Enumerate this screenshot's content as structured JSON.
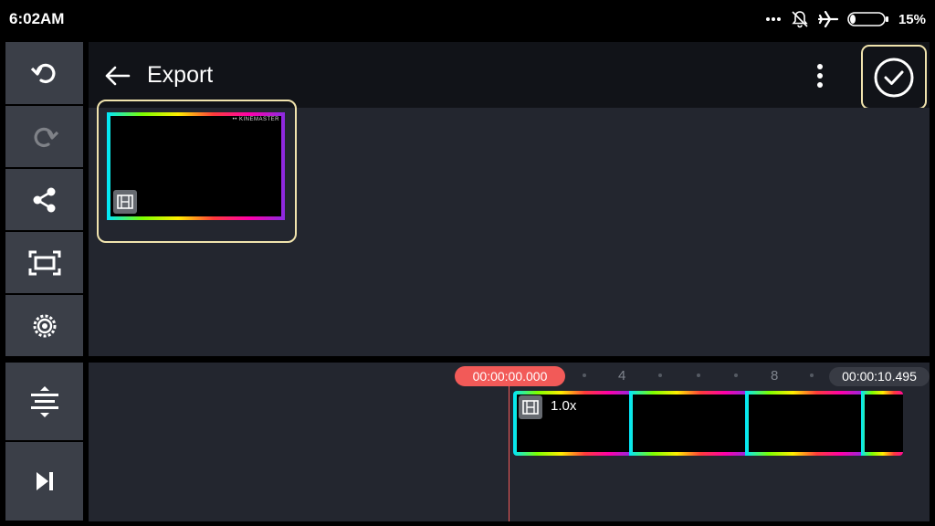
{
  "status_bar": {
    "time": "6:02AM",
    "battery": "15%",
    "icons": [
      "more-dots-icon",
      "bell-off-icon",
      "airplane-icon",
      "battery-icon"
    ]
  },
  "sidebar": {
    "buttons": [
      {
        "icon": "undo-icon",
        "enabled": true
      },
      {
        "icon": "redo-icon",
        "enabled": false
      },
      {
        "icon": "share-icon",
        "enabled": true
      },
      {
        "icon": "fit-screen-icon",
        "enabled": true
      },
      {
        "icon": "settings-icon",
        "enabled": true
      },
      {
        "icon": "expand-timeline-icon",
        "enabled": true
      },
      {
        "icon": "skip-to-end-icon",
        "enabled": true
      }
    ]
  },
  "header": {
    "title": "Export",
    "back_icon": "back-arrow-icon",
    "more_icon": "more-vertical-icon",
    "confirm_icon": "check-circle-icon"
  },
  "media": {
    "thumbnail_logo": "•• KINEMASTER",
    "thumbnail_icon": "film-icon"
  },
  "timeline": {
    "current_time": "00:00:00.000",
    "total_time": "00:00:10.495",
    "ruler_labels": [
      "4",
      "8"
    ],
    "clip_speed": "1.0x"
  },
  "colors": {
    "accent_highlight": "#f0e3ad",
    "playhead": "#f25a58",
    "panel_bg": "#23262f",
    "sidebar_bg": "#3b3f48"
  }
}
